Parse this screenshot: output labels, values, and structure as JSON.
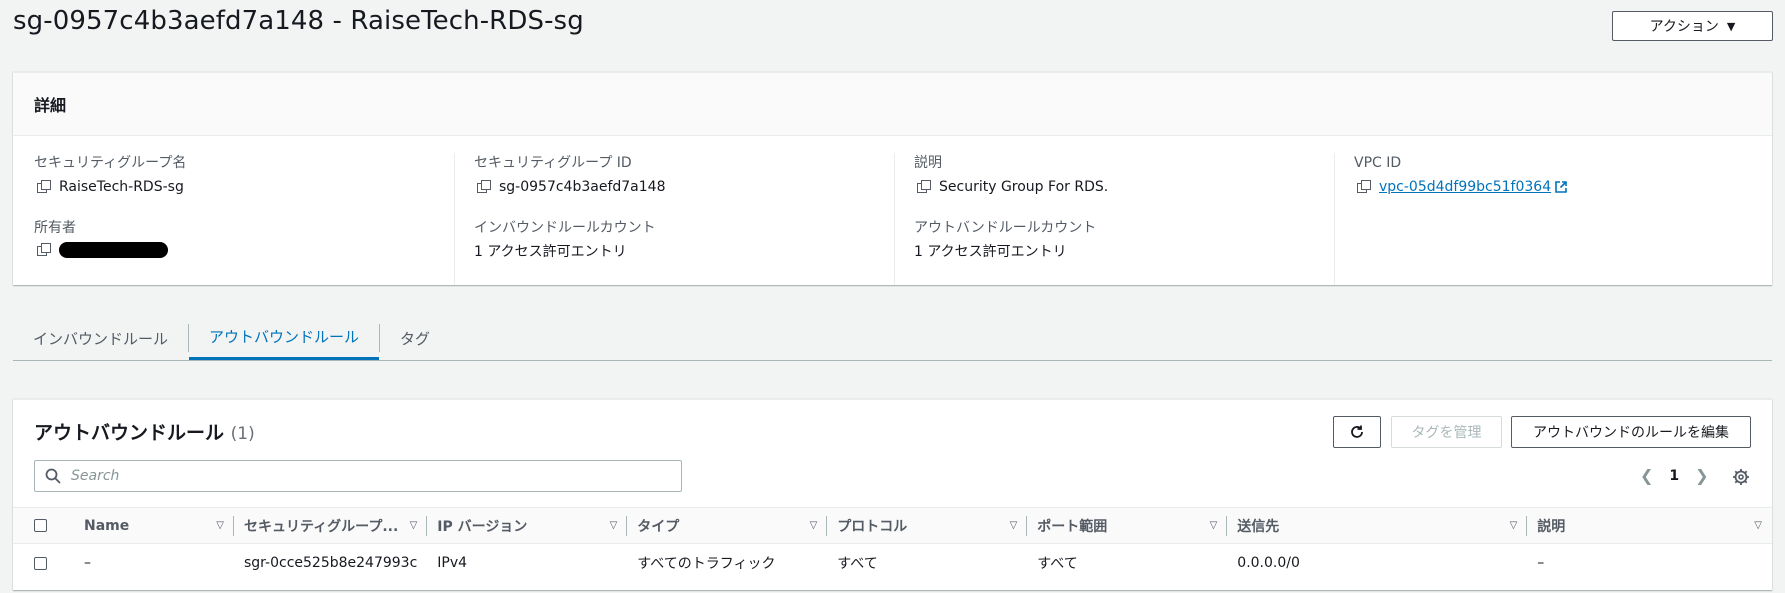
{
  "page": {
    "title": "sg-0957c4b3aefd7a148 - RaiseTech-RDS-sg",
    "action_label": "アクション"
  },
  "details": {
    "header": "詳細",
    "fields": {
      "sg_name_label": "セキュリティグループ名",
      "sg_name_value": "RaiseTech-RDS-sg",
      "sg_id_label": "セキュリティグループ ID",
      "sg_id_value": "sg-0957c4b3aefd7a148",
      "desc_label": "説明",
      "desc_value": "Security Group For RDS.",
      "vpc_label": "VPC ID",
      "vpc_value": "vpc-05d4df99bc51f0364",
      "owner_label": "所有者",
      "inbound_count_label": "インバウンドルールカウント",
      "inbound_count_value": "1 アクセス許可エントリ",
      "outbound_count_label": "アウトバンドルールカウント",
      "outbound_count_value": "1 アクセス許可エントリ"
    }
  },
  "tabs": [
    {
      "label": "インバウンドルール",
      "active": false
    },
    {
      "label": "アウトバウンドルール",
      "active": true
    },
    {
      "label": "タグ",
      "active": false
    }
  ],
  "rules": {
    "title": "アウトバウンドルール",
    "count": "(1)",
    "manage_tags_label": "タグを管理",
    "edit_label": "アウトバウンドのルールを編集",
    "search_placeholder": "Search",
    "page_number": "1",
    "columns": [
      "Name",
      "セキュリティグループ...",
      "IP バージョン",
      "タイプ",
      "プロトコル",
      "ポート範囲",
      "送信先",
      "説明"
    ],
    "rows": [
      [
        "–",
        "sgr-0cce525b8e247993c",
        "IPv4",
        "すべてのトラフィック",
        "すべて",
        "すべて",
        "0.0.0.0/0",
        "–"
      ]
    ]
  },
  "colors": {
    "accent": "#0073bb",
    "background": "#f2f3f3"
  }
}
